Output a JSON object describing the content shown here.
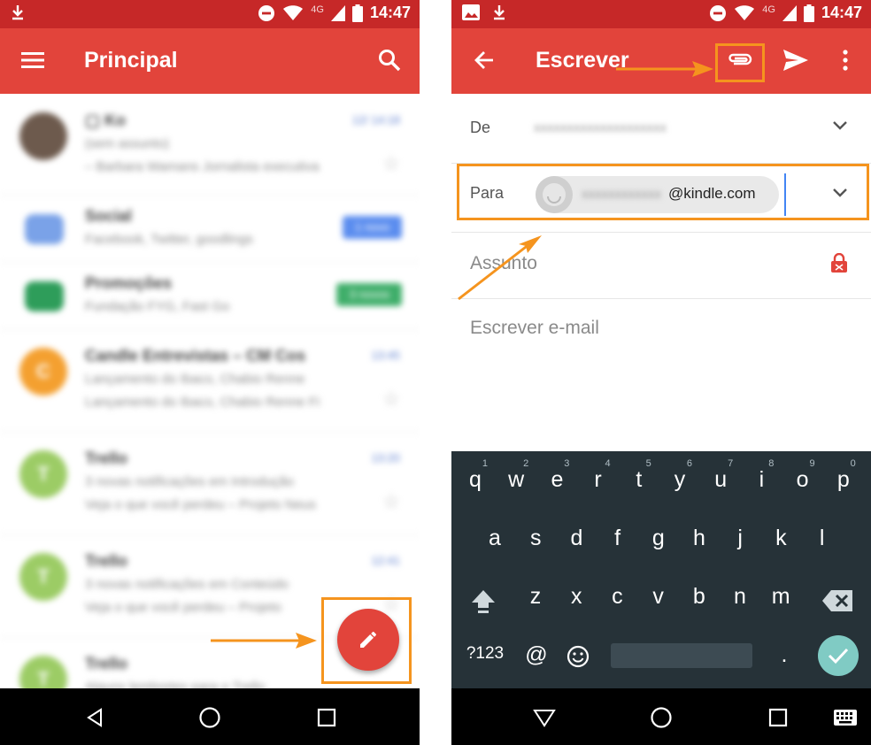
{
  "left_screen": {
    "status_bar": {
      "time": "14:47",
      "network": "4G"
    },
    "app_bar": {
      "title": "Principal"
    },
    "inbox": [
      {
        "initial": "",
        "color": "#6d5a4d",
        "sender": "▢ Ko",
        "date": "12/ 14:18",
        "line1": "(sem assunto)",
        "line2": "– Barbara Wamans Jornalista executiva",
        "chip": "",
        "chip_color": "",
        "has_star": true
      },
      {
        "initial": "",
        "color": "#7aa2e8",
        "sender": "Social",
        "date": "",
        "line1": "Facebook, Twitter, goodlings",
        "line2": "",
        "chip": "1 novo",
        "chip_color": "#5b8def",
        "has_star": false
      },
      {
        "initial": "",
        "color": "#2e9d5a",
        "sender": "Promoções",
        "date": "",
        "line1": "Fundação FYG, Fast Go",
        "line2": "",
        "chip": "3 novos",
        "chip_color": "#3fae6a",
        "has_star": false
      },
      {
        "initial": "C",
        "color": "#f4a030",
        "sender": "Candle Entrevistas – CM Cos",
        "date": "13:45",
        "line1": "Lançamento do Ibaco, Chabio Renne",
        "line2": "Lançamento do Ibaco, Chabio Renne Fi",
        "chip": "",
        "chip_color": "",
        "has_star": true
      },
      {
        "initial": "T",
        "color": "#9ccc65",
        "sender": "Trello",
        "date": "13:20",
        "line1": "3 novas notificações em Introdução",
        "line2": "Veja o que você perdeu – Projeto Neus",
        "chip": "",
        "chip_color": "",
        "has_star": true
      },
      {
        "initial": "T",
        "color": "#9ccc65",
        "sender": "Trello",
        "date": "12:41",
        "line1": "3 novas notificações em Conteúdo",
        "line2": "Veja o que você perdeu – Projeto",
        "chip": "",
        "chip_color": "",
        "has_star": true
      },
      {
        "initial": "T",
        "color": "#9ccc65",
        "sender": "Trello",
        "date": "",
        "line1": "Alguns lembretes para o Trello",
        "line2": "",
        "chip": "",
        "chip_color": "",
        "has_star": false
      }
    ]
  },
  "right_screen": {
    "status_bar": {
      "time": "14:47",
      "network": "4G"
    },
    "app_bar": {
      "title": "Escrever"
    },
    "compose": {
      "from_label": "De",
      "from_value": "xxxxxxxxxxxxxxxxxxxx",
      "to_label": "Para",
      "to_user_blurred": "xxxxxxxxxxxx",
      "to_domain": "@kindle.com",
      "subject_placeholder": "Assunto",
      "body_placeholder": "Escrever e-mail"
    },
    "keyboard": {
      "row1": [
        "q",
        "w",
        "e",
        "r",
        "t",
        "y",
        "u",
        "i",
        "o",
        "p"
      ],
      "row1_hints": [
        "1",
        "2",
        "3",
        "4",
        "5",
        "6",
        "7",
        "8",
        "9",
        "0"
      ],
      "row2": [
        "a",
        "s",
        "d",
        "f",
        "g",
        "h",
        "j",
        "k",
        "l"
      ],
      "row3": [
        "z",
        "x",
        "c",
        "v",
        "b",
        "n",
        "m"
      ],
      "symbols_key": "?123",
      "at_key": "@",
      "period_key": "."
    }
  },
  "colors": {
    "accent_red": "#e2443b",
    "status_red": "#c62828",
    "highlight_orange": "#f5941e",
    "keyboard_bg": "#263238",
    "enter_teal": "#80cbc4"
  }
}
